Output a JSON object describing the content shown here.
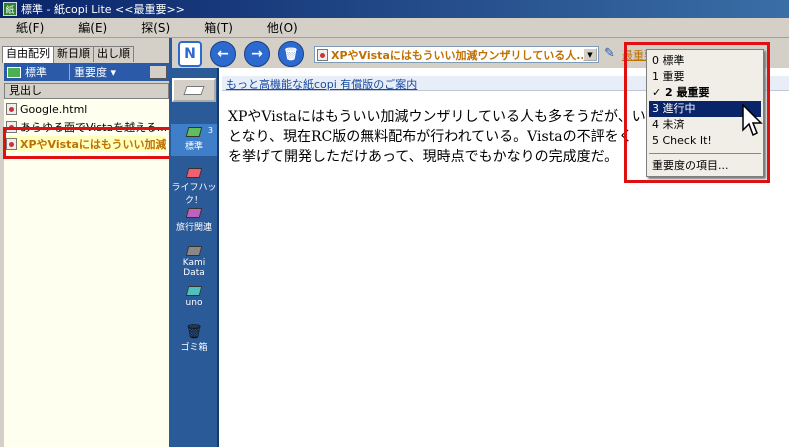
{
  "window": {
    "title": "標準 - 紙copi Lite <<最重要>>",
    "icon_text": "紙"
  },
  "menu": [
    "紙(F)",
    "編(E)",
    "探(S)",
    "箱(T)",
    "他(O)"
  ],
  "left": {
    "tabs": [
      "自由配列",
      "新日順",
      "出し順"
    ],
    "filter_label": "標準",
    "sort_label": "重要度 ▾",
    "list_header": "見出し",
    "docs": [
      {
        "title": "Google.html"
      },
      {
        "title": "あらゆる面でVistaを越える..."
      },
      {
        "title": "XPやVistaにはもういい加減ウ"
      }
    ]
  },
  "categories": [
    {
      "label": "標準",
      "count": "3",
      "color": "#5fbf5f"
    },
    {
      "label": "ライフハック！",
      "count": "",
      "color": "#f06070"
    },
    {
      "label": "旅行関連",
      "count": "",
      "color": "#c060c0"
    },
    {
      "label": "Kami Data",
      "count": "",
      "color": "#888888"
    },
    {
      "label": "uno",
      "count": "",
      "color": "#4fc0c0"
    },
    {
      "label": "ゴミ箱",
      "count": "",
      "color": "#222222"
    }
  ],
  "toolbar": {
    "new_icon": "N",
    "back_icon": "←",
    "forward_icon": "→",
    "trash_icon": "🗑",
    "doc_title": "XPやVistaにはもういい加減ウンザリしている人...",
    "importance_label": "最重要"
  },
  "content": {
    "ad_link": "もっと高機能な紙copi 有償版のご案内",
    "lines": [
      "XPやVistaにはもういい加減ウンザリしている人も多そうだが、い",
      "となり、現在RC版の無料配布が行われている。Vistaの不評をく",
      "を挙げて開発しただけあって、現時点でもかなりの完成度だ。"
    ]
  },
  "dropdown": {
    "items": [
      {
        "label": "0 標準"
      },
      {
        "label": "1 重要"
      },
      {
        "label": "✓ 2 最重要"
      },
      {
        "label": "3 進行中"
      },
      {
        "label": "4 未済"
      },
      {
        "label": "5 Check It!"
      }
    ],
    "footer": "重要度の項目..."
  }
}
